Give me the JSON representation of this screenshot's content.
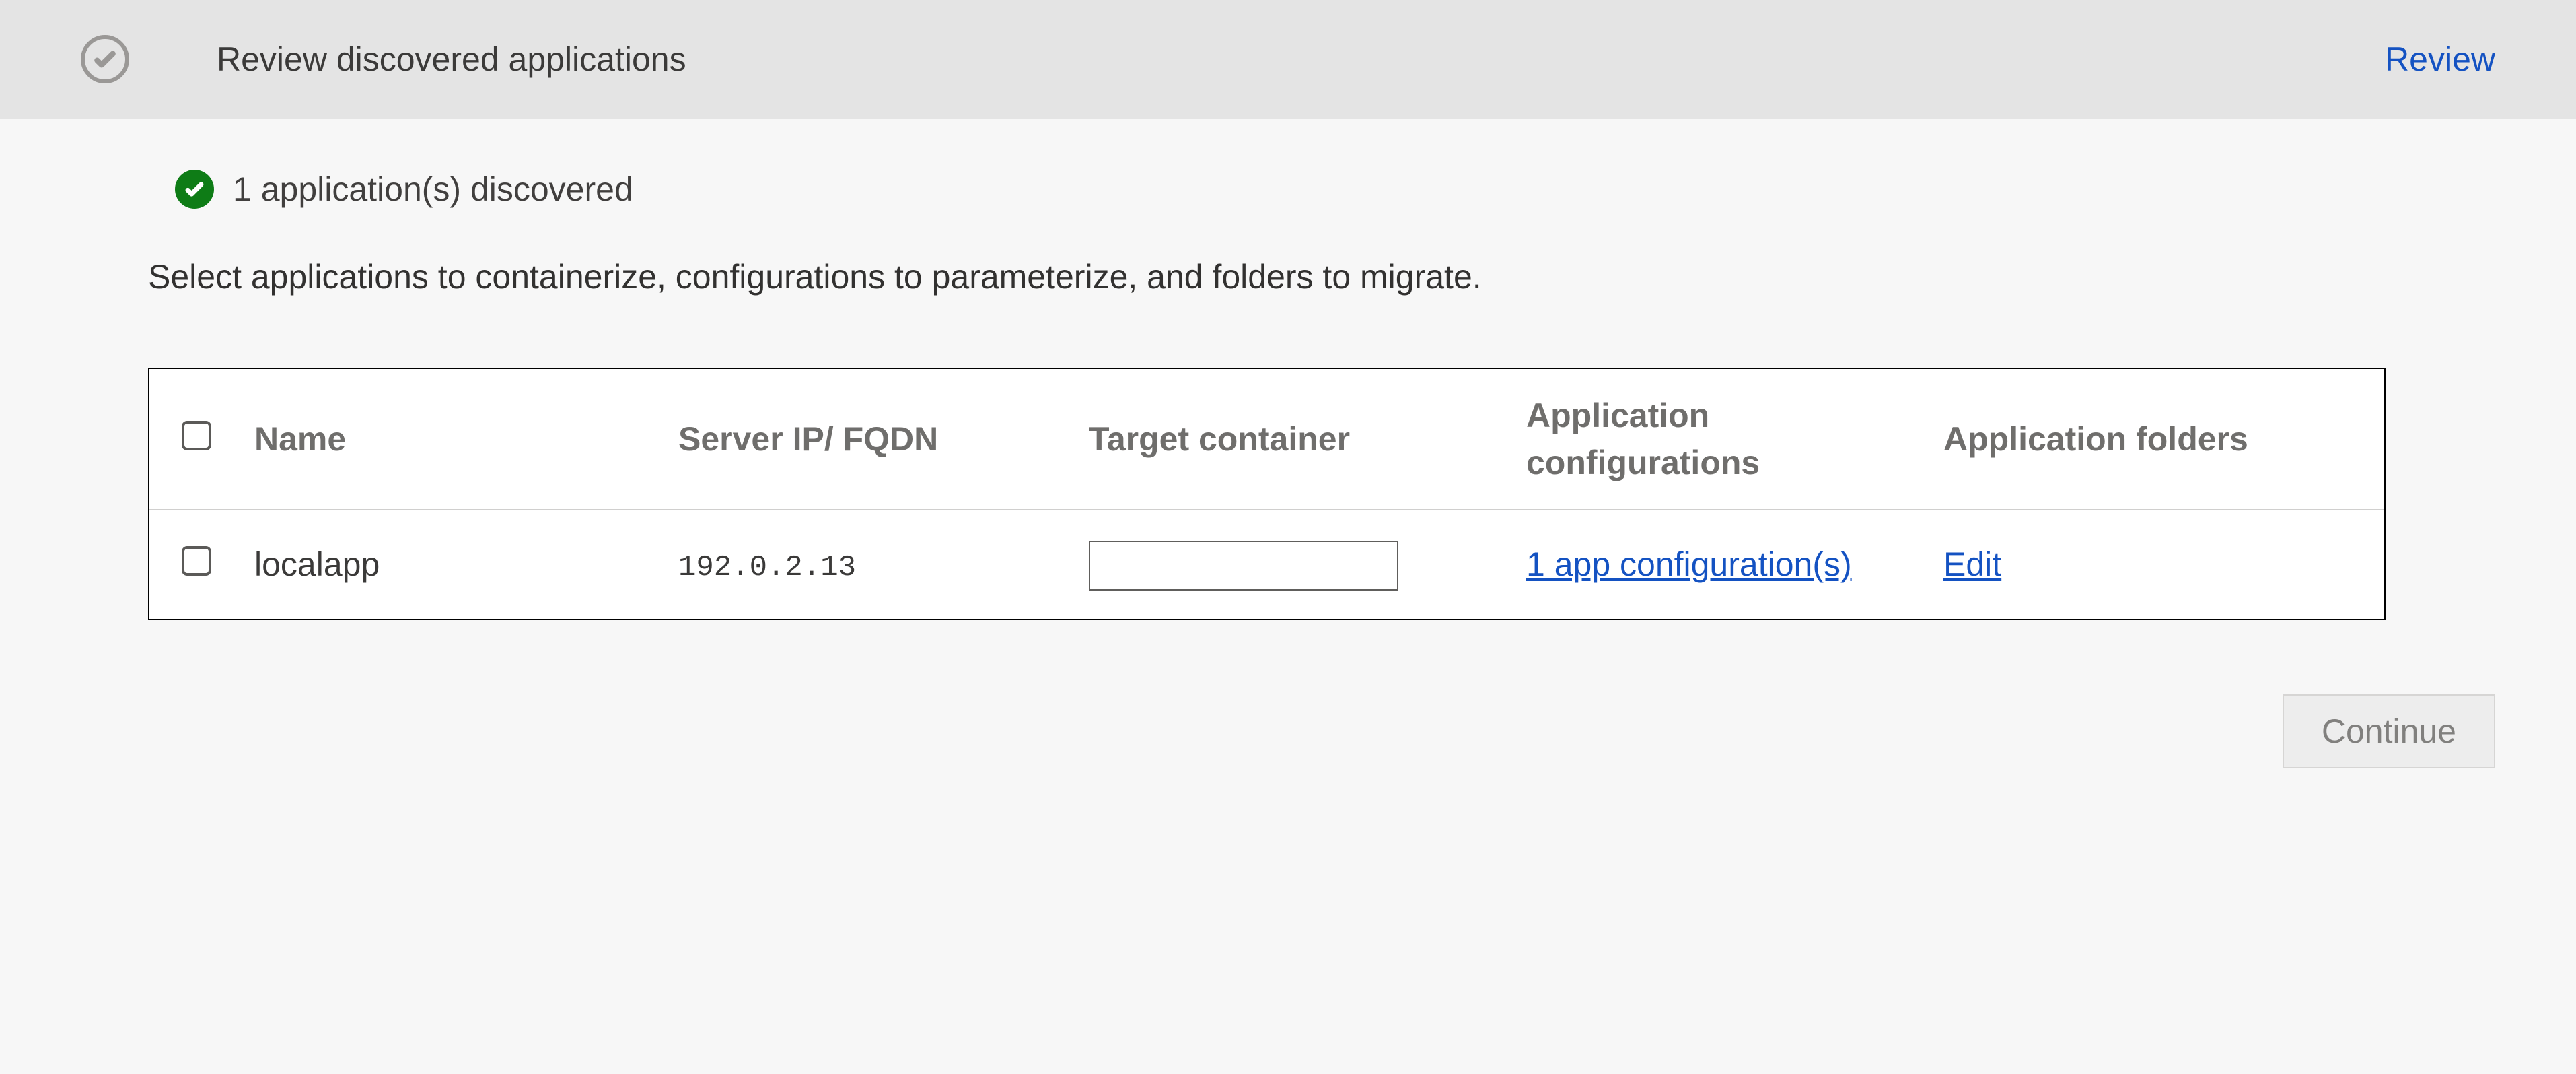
{
  "header": {
    "title": "Review discovered applications",
    "review_link": "Review"
  },
  "status": {
    "message": "1 application(s) discovered"
  },
  "instruction": "Select applications to containerize, configurations to parameterize, and folders to migrate.",
  "table": {
    "headers": {
      "name": "Name",
      "server": "Server IP/ FQDN",
      "target": "Target container",
      "config": "Application configurations",
      "folders": "Application folders"
    },
    "rows": [
      {
        "name": "localapp",
        "server": "192.0.2.13",
        "target_value": "",
        "config_link": "1 app configuration(s)",
        "folders_link": "Edit"
      }
    ]
  },
  "footer": {
    "continue_label": "Continue"
  }
}
